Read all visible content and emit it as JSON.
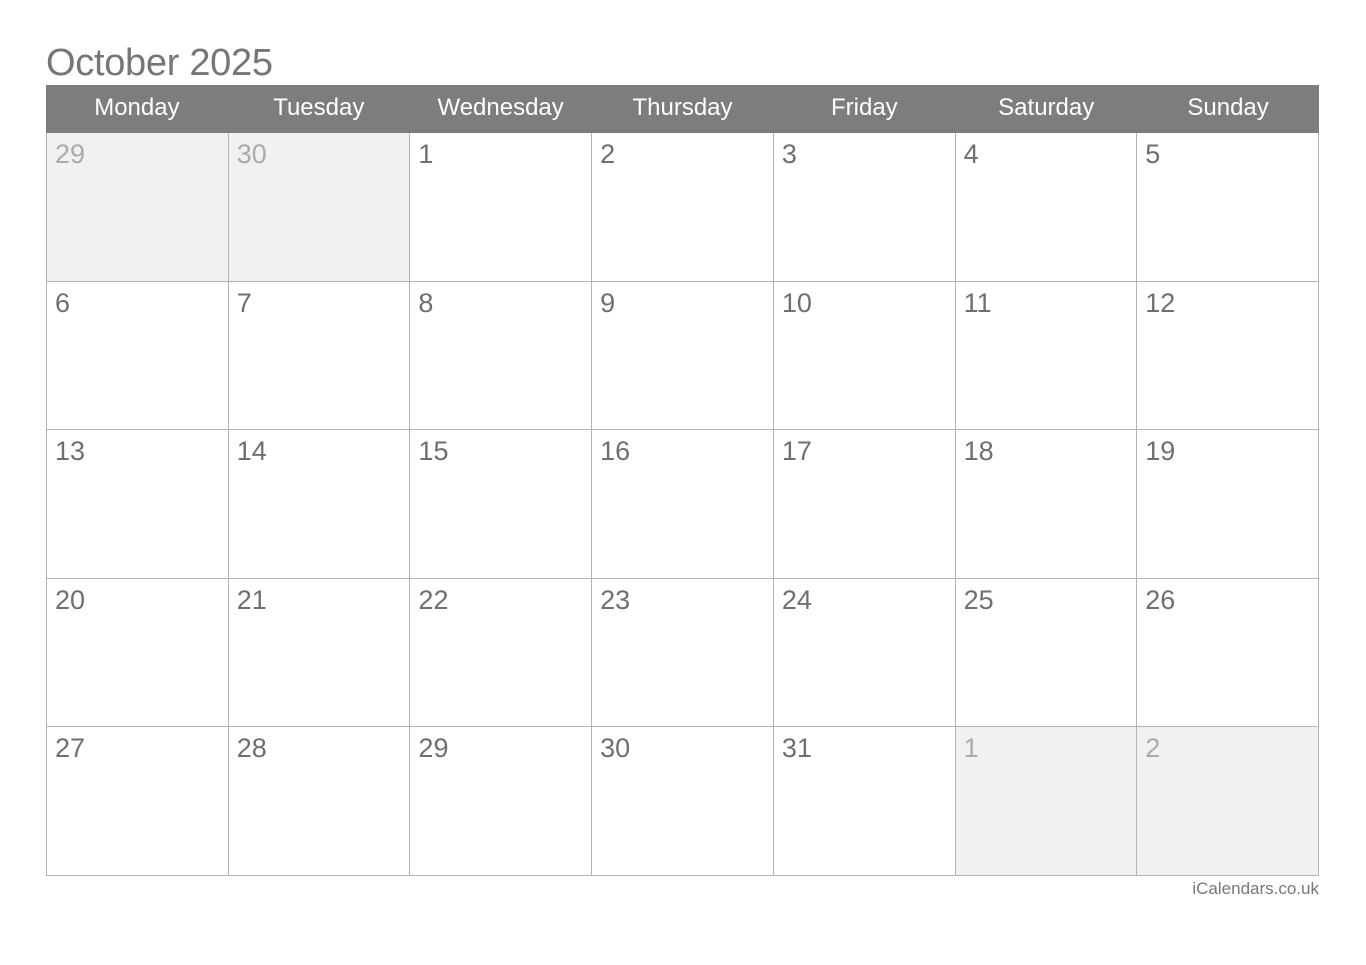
{
  "title": "October 2025",
  "weekdays": [
    "Monday",
    "Tuesday",
    "Wednesday",
    "Thursday",
    "Friday",
    "Saturday",
    "Sunday"
  ],
  "weeks": [
    [
      {
        "day": "29",
        "other": true
      },
      {
        "day": "30",
        "other": true
      },
      {
        "day": "1"
      },
      {
        "day": "2"
      },
      {
        "day": "3"
      },
      {
        "day": "4"
      },
      {
        "day": "5"
      }
    ],
    [
      {
        "day": "6"
      },
      {
        "day": "7"
      },
      {
        "day": "8"
      },
      {
        "day": "9"
      },
      {
        "day": "10"
      },
      {
        "day": "11"
      },
      {
        "day": "12"
      }
    ],
    [
      {
        "day": "13"
      },
      {
        "day": "14"
      },
      {
        "day": "15"
      },
      {
        "day": "16"
      },
      {
        "day": "17"
      },
      {
        "day": "18"
      },
      {
        "day": "19"
      }
    ],
    [
      {
        "day": "20"
      },
      {
        "day": "21"
      },
      {
        "day": "22"
      },
      {
        "day": "23"
      },
      {
        "day": "24"
      },
      {
        "day": "25"
      },
      {
        "day": "26"
      }
    ],
    [
      {
        "day": "27"
      },
      {
        "day": "28"
      },
      {
        "day": "29"
      },
      {
        "day": "30"
      },
      {
        "day": "31"
      },
      {
        "day": "1",
        "other": true
      },
      {
        "day": "2",
        "other": true
      }
    ]
  ],
  "footer": "iCalendars.co.uk",
  "colors": {
    "header_bg": "#7d7d7d",
    "other_month_bg": "#f1f1f1",
    "grid_line": "#b4b4b4"
  }
}
